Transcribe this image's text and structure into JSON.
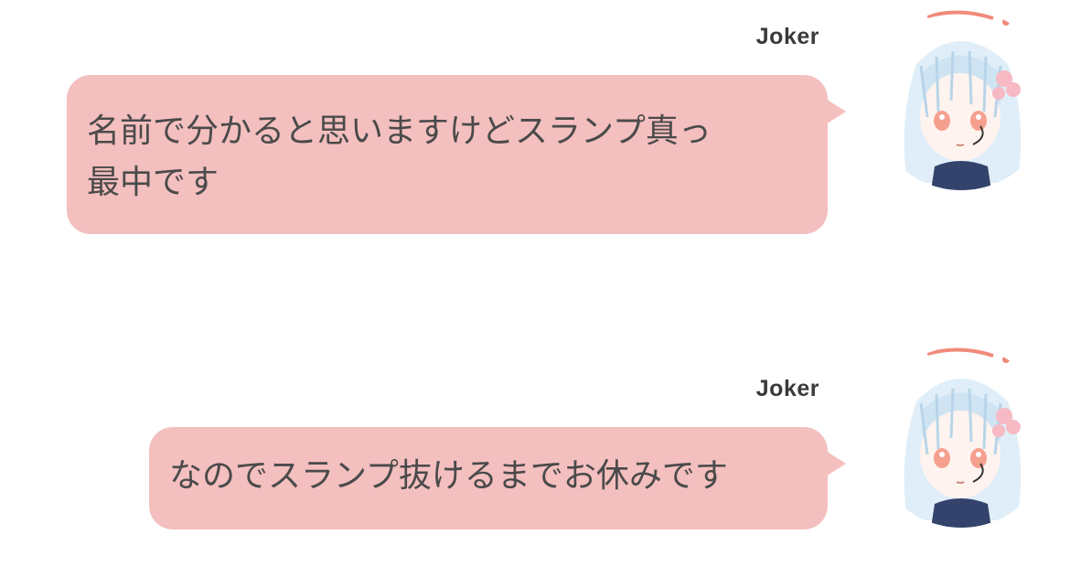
{
  "theme": {
    "bubble_color": "#f4bfbf",
    "text_color": "#4a4a4a",
    "name_color": "#3a3a3a"
  },
  "messages": [
    {
      "sender": "Joker",
      "lines": [
        "名前で分かると思いますけどスランプ真っ",
        "最中です"
      ],
      "avatar_icon": "anime-girl-avatar-icon"
    },
    {
      "sender": "Joker",
      "lines": [
        "なのでスランプ抜けるまでお休みです"
      ],
      "avatar_icon": "anime-girl-avatar-icon"
    }
  ]
}
